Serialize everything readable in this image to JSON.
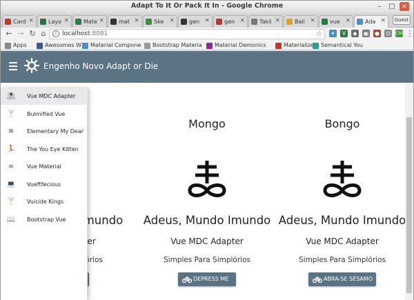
{
  "window": {
    "title": "Adapt To It Or Pack It In - Google Chrome",
    "guest_label": "Guest"
  },
  "tabs": [
    {
      "label": "Card",
      "color": "#c0392b"
    },
    {
      "label": "Layo",
      "color": "#2c6e49"
    },
    {
      "label": "Mate",
      "color": "#2d7d46"
    },
    {
      "label": "mat",
      "color": "#333333"
    },
    {
      "label": "Ske",
      "color": "#3f8f3f"
    },
    {
      "label": "gen",
      "color": "#333333"
    },
    {
      "label": "gen",
      "color": "#b23a3a"
    },
    {
      "label": "Takii",
      "color": "#777777"
    },
    {
      "label": "Bali",
      "color": "#e6a21a"
    },
    {
      "label": "vue",
      "color": "#2b7a3d"
    },
    {
      "label": "Ada",
      "color": "#4a90c8"
    }
  ],
  "toolbar": {
    "url_host": "localhost",
    "url_port": ":8081"
  },
  "bookmarks": [
    {
      "label": "Apps",
      "color": "#888888"
    },
    {
      "label": "Awesomes W3",
      "color": "#3b5998"
    },
    {
      "label": "Material Compone",
      "color": "#4a90c8"
    },
    {
      "label": "Bootstrap Materia",
      "color": "#999999"
    },
    {
      "label": "Material Demonics",
      "color": "#8e2b8e"
    },
    {
      "label": "Materialize-o",
      "color": "#c0392b"
    },
    {
      "label": "Semantical You",
      "color": "#2e9c8f"
    }
  ],
  "app": {
    "title": "Engenho Novo Adapt or Die",
    "bar_color": "#5b7382"
  },
  "drawer": [
    {
      "label": "Vue MDC Adapter",
      "icon": "beach-umbrella-icon",
      "glyph": "⛱",
      "selected": true
    },
    {
      "label": "Bulmified Vue",
      "icon": "cocktail-icon",
      "glyph": "🍸",
      "selected": false
    },
    {
      "label": "Elementary My Dear",
      "icon": "waves-icon",
      "glyph": "≋",
      "selected": false
    },
    {
      "label": "The You Eye Kitten",
      "icon": "runner-icon",
      "glyph": "🏃",
      "selected": false
    },
    {
      "label": "Vue Material",
      "icon": "infinity-icon",
      "glyph": "∞",
      "selected": false
    },
    {
      "label": "Vueftfecious",
      "icon": "laptop-icon",
      "glyph": "💻",
      "selected": false
    },
    {
      "label": "Vuicide Kings",
      "icon": "cocktail-icon",
      "glyph": "🍸",
      "selected": false
    },
    {
      "label": "Bootstrap Vue",
      "icon": "book-icon",
      "glyph": "📖",
      "selected": false
    }
  ],
  "cards": [
    {
      "title": "",
      "heading": "Adeus, Mundo Imundo",
      "subheading": "Vue MDC Adapter",
      "text": "Simples Para Simplórios",
      "button": "DEPRESS ME"
    },
    {
      "title": "Mongo",
      "heading": "Adeus, Mundo Imundo",
      "subheading": "Vue MDC Adapter",
      "text": "Simples Para Simplórios",
      "button": "DEPRESS ME"
    },
    {
      "title": "Bongo",
      "heading": "Adeus, Mundo Imundo",
      "subheading": "Vue MDC Adapter",
      "text": "Simples Para Simplórios",
      "button": "ABRA-SE SÉSAMO"
    }
  ]
}
